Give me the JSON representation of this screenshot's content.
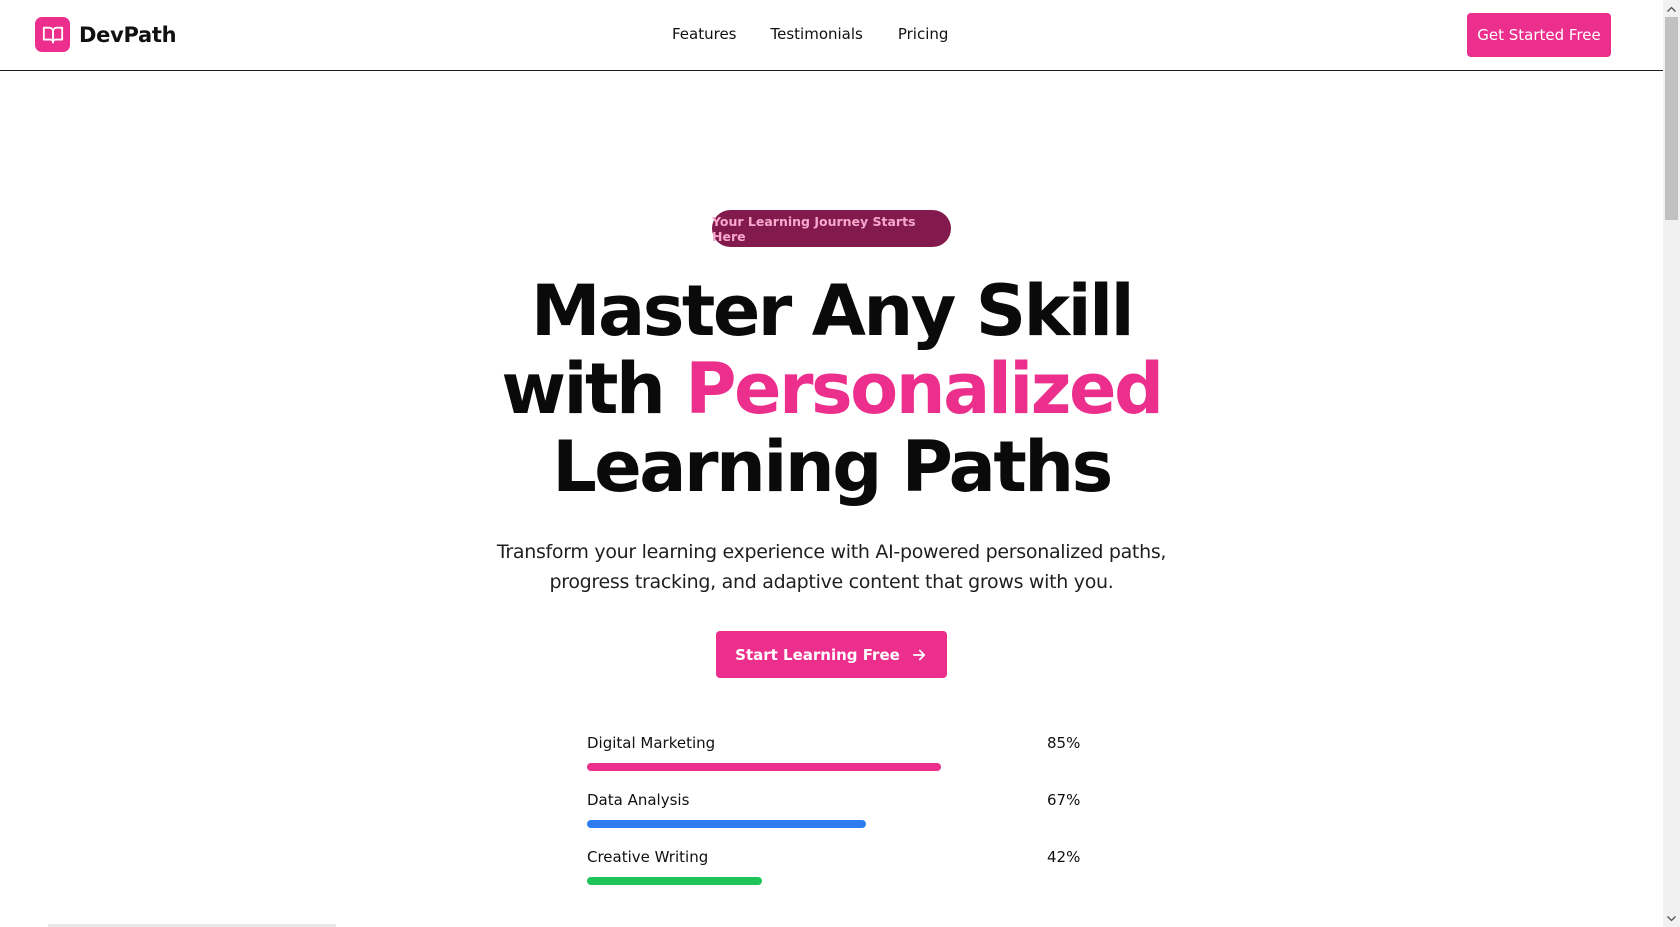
{
  "brand": {
    "name": "DevPath",
    "logo_icon": "open-book-icon",
    "accent": "#ec2f8c"
  },
  "nav": {
    "items": [
      {
        "label": "Features"
      },
      {
        "label": "Testimonials"
      },
      {
        "label": "Pricing"
      }
    ],
    "cta_label": "Get Started Free"
  },
  "hero": {
    "badge": "Your Learning Journey Starts Here",
    "headline_line1": "Master Any Skill",
    "headline_with": "with",
    "headline_accent": "Personalized",
    "headline_line3": "Learning Paths",
    "subtitle": "Transform your learning experience with AI-powered personalized paths, progress tracking, and adaptive content that grows with you.",
    "cta_label": "Start Learning Free",
    "cta_icon": "arrow-right-icon"
  },
  "progress": [
    {
      "label": "Digital Marketing",
      "percent": "85%",
      "value": 85,
      "color": "#ec2f8c"
    },
    {
      "label": "Data Analysis",
      "percent": "67%",
      "value": 67,
      "color": "#2f7bf0"
    },
    {
      "label": "Creative Writing",
      "percent": "42%",
      "value": 42,
      "color": "#1ec45a"
    }
  ]
}
